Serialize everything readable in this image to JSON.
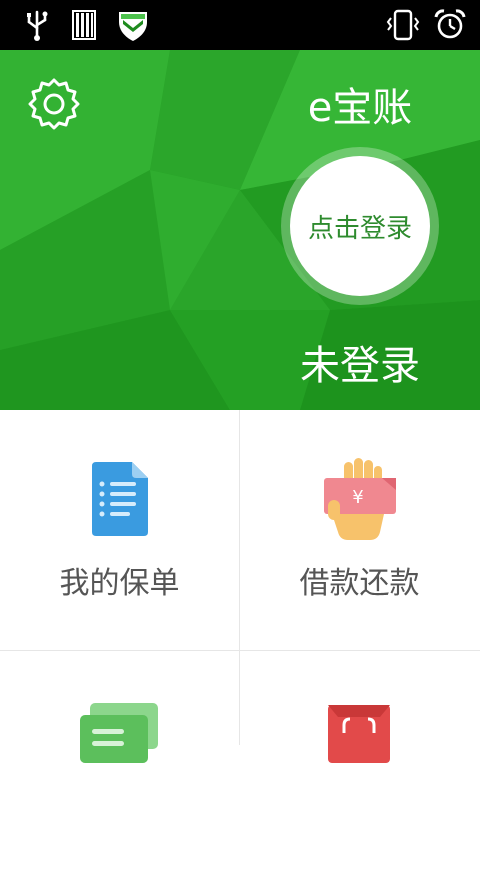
{
  "status_bar": {
    "left_icons": [
      "usb-icon",
      "sim-card-icon",
      "security-shield-icon"
    ],
    "right_icons": [
      "vibrate-icon",
      "alarm-icon"
    ]
  },
  "header": {
    "app_title": "e宝账",
    "login_button_label": "点击登录",
    "login_status": "未登录",
    "settings_icon": "gear-icon",
    "background_color": "#2aa52a"
  },
  "menu": {
    "items": [
      {
        "label": "我的保单",
        "icon": "policy-document-icon"
      },
      {
        "label": "借款还款",
        "icon": "loan-repay-icon"
      },
      {
        "label": "",
        "icon": "chat-messages-icon"
      },
      {
        "label": "",
        "icon": "shopping-bag-icon"
      }
    ]
  }
}
